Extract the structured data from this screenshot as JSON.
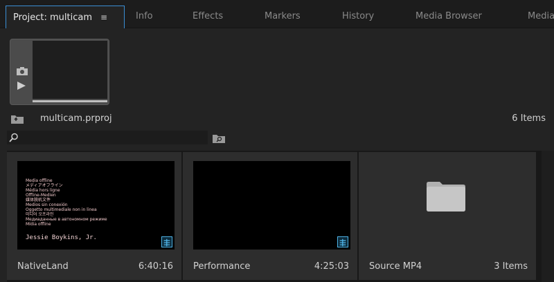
{
  "tabs": [
    {
      "label": "Project: multicam",
      "active": true,
      "menu_glyph": "≡"
    },
    {
      "label": "Info"
    },
    {
      "label": "Effects"
    },
    {
      "label": "Markers"
    },
    {
      "label": "History"
    },
    {
      "label": "Media Browser"
    },
    {
      "label": "Media"
    }
  ],
  "project": {
    "file_name": "multicam.prproj",
    "item_count": "6 Items"
  },
  "search": {
    "placeholder": ""
  },
  "items": [
    {
      "name": "NativeLand",
      "meta": "6:40:16",
      "thumbnail": "media-offline",
      "offline_lines": [
        "Media offline",
        "メディアオフライン",
        "Média hors ligne",
        "Offline-Medien",
        "媒体脱机文件",
        "Medios sin conexión",
        "Oggetto multimediale non in linea",
        "미디어 오프라인",
        "Медиаданные в автономном режиме",
        "Mídia offline"
      ],
      "offline_owner": "Jessie Boykins, Jr."
    },
    {
      "name": "Performance",
      "meta": "4:25:03",
      "thumbnail": "black"
    },
    {
      "name": "Source MP4",
      "meta": "3 Items",
      "thumbnail": "folder"
    }
  ],
  "colors": {
    "accent": "#3a8fd6",
    "badge": "#4fb4e8",
    "offline_red": "#d9424d"
  }
}
